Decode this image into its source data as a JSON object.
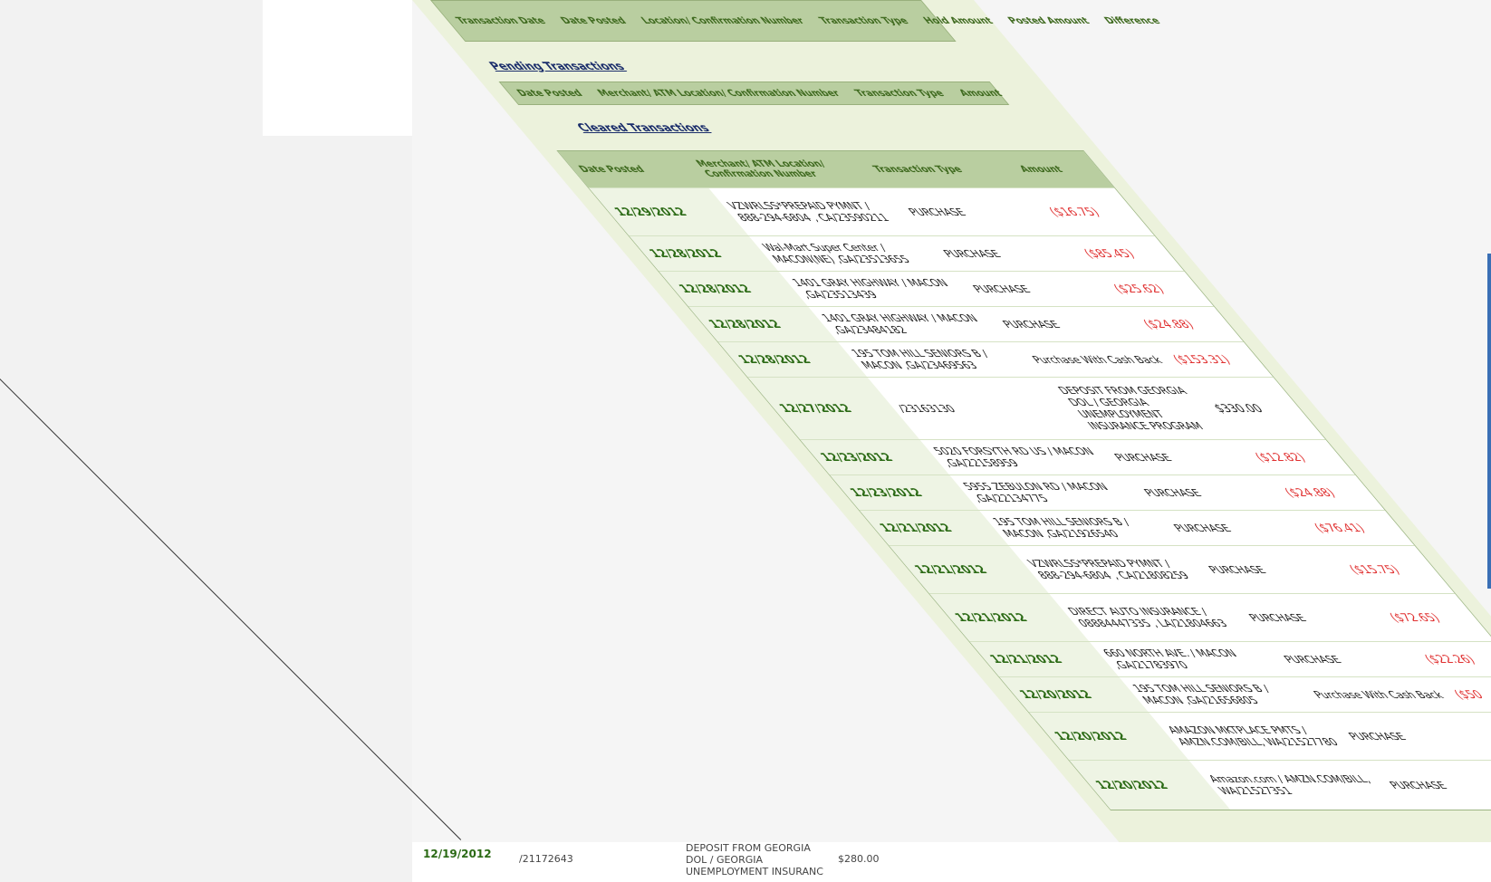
{
  "top_table": {
    "headers": [
      "Transaction Date",
      "Date Posted",
      "Location/ Confirmation Number",
      "Transaction Type",
      "Hold Amount",
      "Posted Amount",
      "Difference"
    ]
  },
  "pending": {
    "title": "Pending Transactions",
    "headers": [
      "Date Posted",
      "Merchant/ ATM Location/ Confirmation Number",
      "Transaction Type",
      "Amount"
    ]
  },
  "cleared": {
    "title": "Cleared Transactions",
    "headers": [
      "Date Posted",
      "Merchant/ ATM Location/ Confirmation Number",
      "Transaction Type",
      "Amount"
    ],
    "rows": [
      {
        "date": "12/29/2012",
        "merchant": "VZWRLSS*PREPAID PYMNT / 888-294-6804 , CA/23590211",
        "type": "PURCHASE",
        "amount": "($16.75)",
        "neg": true
      },
      {
        "date": "12/28/2012",
        "merchant": "Wal-Mart Super Center / MACON(NE) ,GA/23513655",
        "type": "PURCHASE",
        "amount": "($85.45)",
        "neg": true
      },
      {
        "date": "12/28/2012",
        "merchant": "1401 GRAY HIGHWAY / MACON ,GA/23513439",
        "type": "PURCHASE",
        "amount": "($25.62)",
        "neg": true
      },
      {
        "date": "12/28/2012",
        "merchant": "1401 GRAY HIGHWAY / MACON ,GA/23484182",
        "type": "PURCHASE",
        "amount": "($24.88)",
        "neg": true
      },
      {
        "date": "12/28/2012",
        "merchant": "195 TOM HILL SENIORS B / MACON ,GA/23469563",
        "type": "Purchase With Cash Back",
        "amount": "($153.31)",
        "neg": true
      },
      {
        "date": "12/27/2012",
        "merchant": "/23163130",
        "type": "DEPOSIT FROM GEORGIA DOL / GEORGIA UNEMPLOYMENT INSURANCE PROGRAM",
        "amount": "$330.00",
        "neg": false
      },
      {
        "date": "12/23/2012",
        "merchant": "5020 FORSYTH RD US / MACON ,GA/22158959",
        "type": "PURCHASE",
        "amount": "($12.82)",
        "neg": true
      },
      {
        "date": "12/23/2012",
        "merchant": "5955 ZEBULON RD / MACON ,GA/22134775",
        "type": "PURCHASE",
        "amount": "($24.88)",
        "neg": true
      },
      {
        "date": "12/21/2012",
        "merchant": "195 TOM HILL SENIORS B / MACON ,GA/21926540",
        "type": "PURCHASE",
        "amount": "($76.41)",
        "neg": true
      },
      {
        "date": "12/21/2012",
        "merchant": "VZWRLSS*PREPAID PYMNT / 888-294-6804 , CA/21808259",
        "type": "PURCHASE",
        "amount": "($15.75)",
        "neg": true
      },
      {
        "date": "12/21/2012",
        "merchant": "DIRECT AUTO INSURANCE / 08884447335 , LA/21804663",
        "type": "PURCHASE",
        "amount": "($72.65)",
        "neg": true
      },
      {
        "date": "12/21/2012",
        "merchant": "660 NORTH AVE. / MACON ,GA/21783970",
        "type": "PURCHASE",
        "amount": "($22.26)",
        "neg": true
      },
      {
        "date": "12/20/2012",
        "merchant": "195 TOM HILL SENIORS B / MACON ,GA/21656805",
        "type": "Purchase With Cash Back",
        "amount": "($50",
        "neg": true
      },
      {
        "date": "12/20/2012",
        "merchant": "AMAZON MKTPLACE PMTS / AMZN.COM/BILL, WA/21527780",
        "type": "PURCHASE",
        "amount": "",
        "neg": true
      },
      {
        "date": "12/20/2012",
        "merchant": "Amazon.com / AMZN.COM/BILL, WA/21527351",
        "type": "PURCHASE",
        "amount": "",
        "neg": true
      }
    ]
  },
  "bottom_ghost": {
    "date": "12/19/2012",
    "merchant": "/21172643",
    "type": "DEPOSIT FROM GEORGIA DOL / GEORGIA UNEMPLOYMENT INSURANC",
    "amount": "$280.00"
  },
  "colors": {
    "header_bg": "#b9cea0",
    "date_green": "#2b6a15",
    "negative_red": "#e03030",
    "section_blue": "#1b2e6b"
  }
}
